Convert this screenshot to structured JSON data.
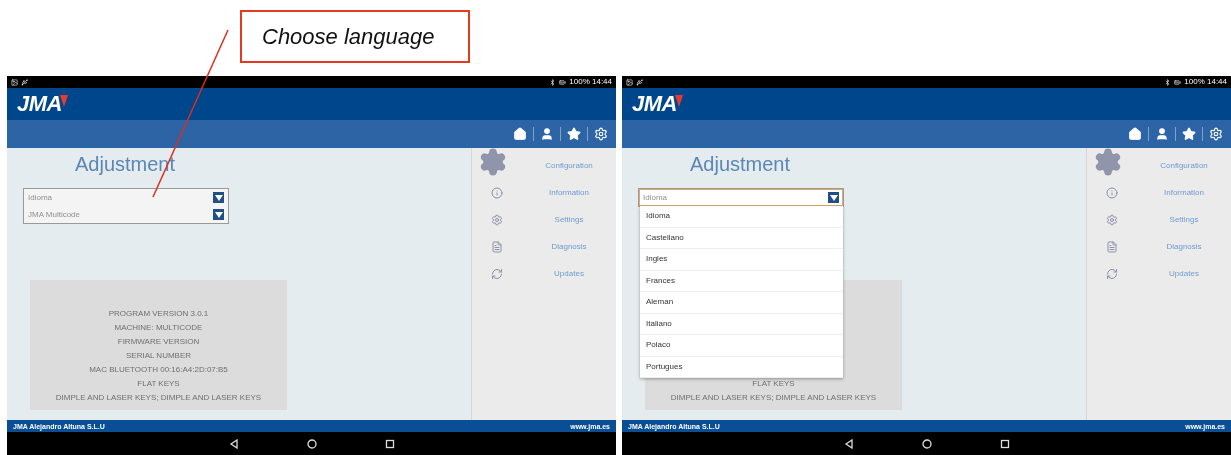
{
  "callout": {
    "text": "Choose language"
  },
  "screens": [
    {
      "status_bar": {
        "text": "100% 14:44"
      },
      "logo": "JMA",
      "title": "Adjustment",
      "selects": [
        {
          "value": "Idioma",
          "focused": false
        },
        {
          "value": "JMA Multicode",
          "focused": false
        }
      ],
      "info_lines": [
        "PROGRAM VERSION 3.0.1",
        "MACHINE: MULTICODE",
        "FIRMWARE VERSION",
        "SERIAL NUMBER",
        "MAC BLUETOOTH 00:16:A4:2D:07:B5",
        "FLAT KEYS",
        "DIMPLE AND LASER KEYS; DIMPLE AND LASER KEYS"
      ],
      "sidebar": [
        {
          "label": "Configuration"
        },
        {
          "label": "Information"
        },
        {
          "label": "Settings"
        },
        {
          "label": "Diagnosis"
        },
        {
          "label": "Updates"
        }
      ],
      "footer": {
        "company": "JMA Alejandro Altuna S.L.U",
        "website": "www.jma.es"
      }
    },
    {
      "status_bar": {
        "text": "100% 14:44"
      },
      "logo": "JMA",
      "title": "Adjustment",
      "selects": [
        {
          "value": "Idioma",
          "focused": true
        }
      ],
      "dropdown": {
        "options": [
          "Idioma",
          "Castellano",
          "Ingles",
          "Frances",
          "Aleman",
          "Italiano",
          "Polaco",
          "Portugues"
        ]
      },
      "info_lines": [
        "FLAT KEYS",
        "DIMPLE AND LASER KEYS; DIMPLE AND LASER KEYS"
      ],
      "sidebar": [
        {
          "label": "Configuration"
        },
        {
          "label": "Information"
        },
        {
          "label": "Settings"
        },
        {
          "label": "Diagnosis"
        },
        {
          "label": "Updates"
        }
      ],
      "footer": {
        "company": "JMA Alejandro Altuna S.L.U",
        "website": "www.jma.es"
      }
    }
  ]
}
